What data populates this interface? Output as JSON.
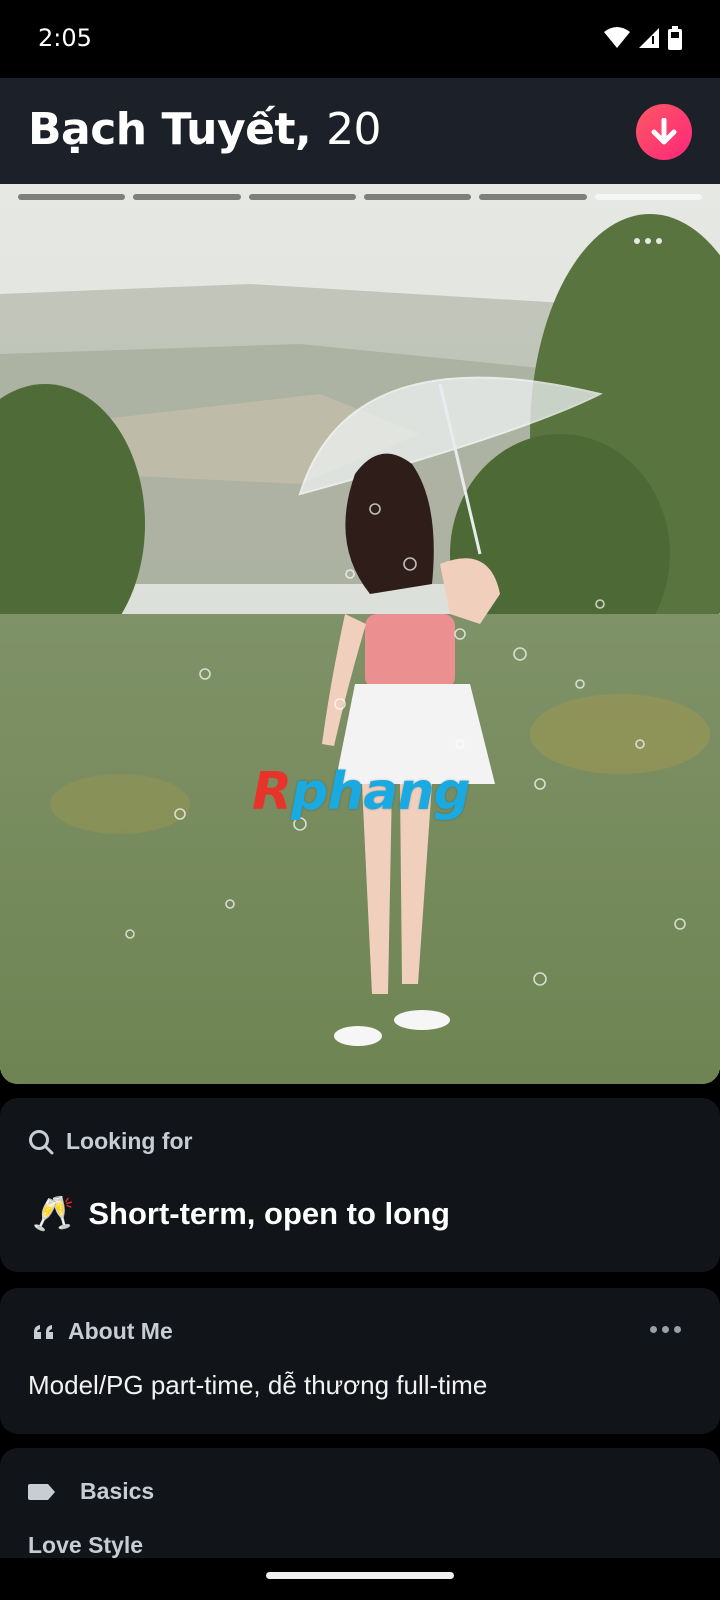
{
  "status_bar": {
    "time": "2:05",
    "icons": [
      "wifi-icon",
      "signal-icon",
      "battery-icon"
    ]
  },
  "profile": {
    "name": "Bạch Tuyết,",
    "age": "20",
    "collapse_icon": "arrow-down-icon",
    "accent_color": "#fd4a6c"
  },
  "photo": {
    "photo_count": 6,
    "active_index": 5,
    "watermark_first": "R",
    "watermark_rest": "phang"
  },
  "looking_for": {
    "label": "Looking for",
    "icon": "search-icon",
    "emoji": "🥂",
    "value": "Short-term, open to long"
  },
  "about_me": {
    "label": "About Me",
    "icon": "quote-icon",
    "text": "Model/PG part-time, dễ thương full-time"
  },
  "basics": {
    "label": "Basics",
    "icon": "tag-icon",
    "sub_label": "Love Style"
  }
}
